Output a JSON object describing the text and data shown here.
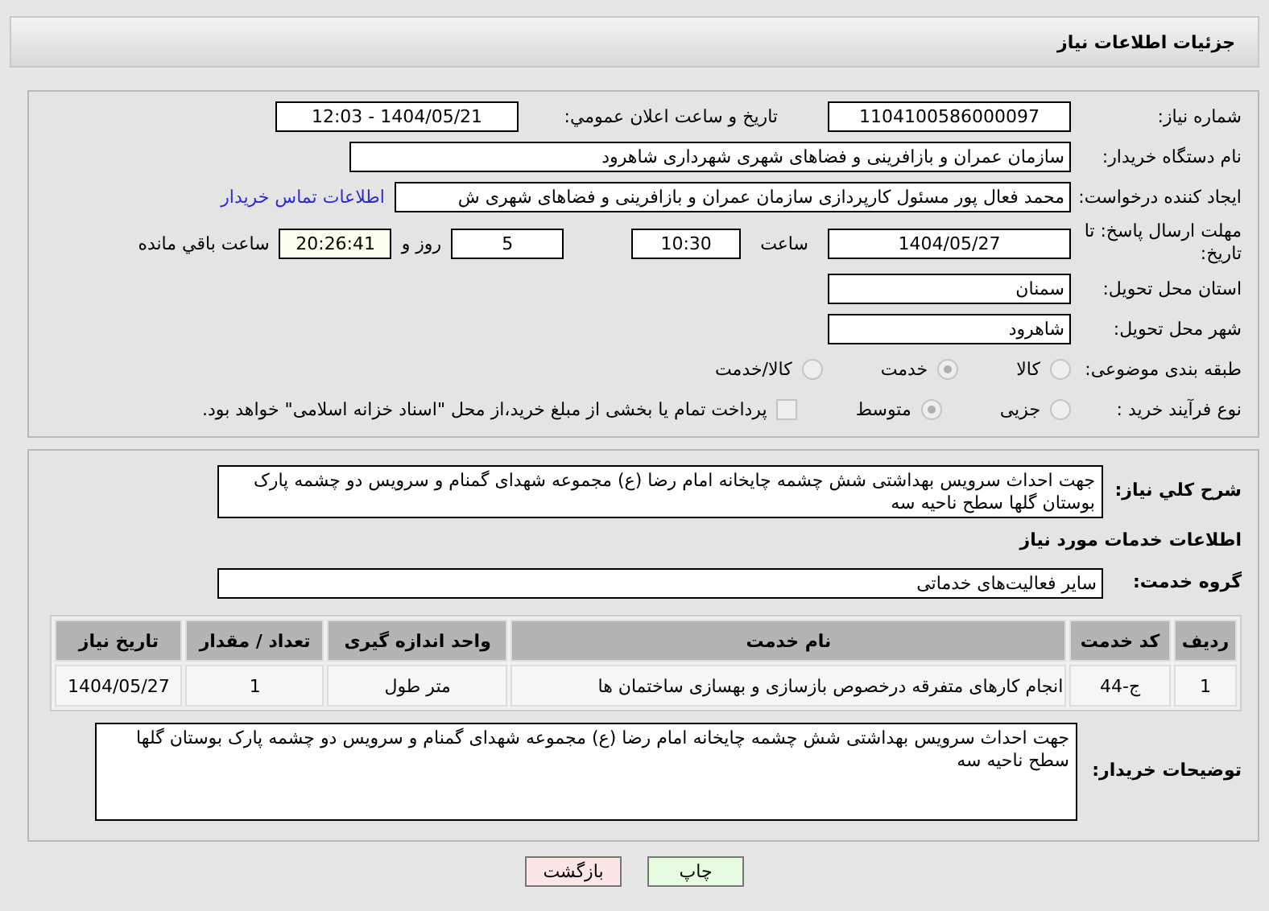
{
  "header": {
    "title": "جزئیات اطلاعات نیاز"
  },
  "details": {
    "need_number": {
      "label": "شماره نیاز:",
      "value": "1104100586000097"
    },
    "announce": {
      "label": "تاریخ و ساعت اعلان عمومي:",
      "value": "1404/05/21 - 12:03"
    },
    "buyer_org": {
      "label": "نام دستگاه خریدار:",
      "value": "سازمان عمران و بازافرینی و فضاهای شهری شهرداری شاهرود"
    },
    "requester": {
      "label": "ایجاد کننده درخواست:",
      "value": "محمد فعال پور مسئول کارپردازی سازمان عمران و بازافرینی و فضاهای شهری ش",
      "link": "اطلاعات تماس خریدار"
    },
    "deadline": {
      "label": "مهلت ارسال پاسخ: تا تاریخ:",
      "date": "1404/05/27",
      "time_label": "ساعت",
      "time": "10:30",
      "days": "5",
      "days_label": "روز و",
      "remaining": "20:26:41",
      "remaining_label": "ساعت باقي مانده"
    },
    "province": {
      "label": "استان محل تحویل:",
      "value": "سمنان"
    },
    "city": {
      "label": "شهر محل تحویل:",
      "value": "شاهرود"
    },
    "category": {
      "label": "طبقه بندی موضوعی:",
      "options": [
        {
          "label": "کالا",
          "selected": false
        },
        {
          "label": "خدمت",
          "selected": true
        },
        {
          "label": "کالا/خدمت",
          "selected": false
        }
      ]
    },
    "process": {
      "label": "نوع فرآیند خرید :",
      "options": [
        {
          "kind": "radio",
          "label": "جزیی",
          "selected": false
        },
        {
          "kind": "radio",
          "label": "متوسط",
          "selected": true
        },
        {
          "kind": "checkbox",
          "label": "پرداخت تمام یا بخشی از مبلغ خرید،از محل \"اسناد خزانه اسلامی\" خواهد بود.",
          "checked": false
        }
      ]
    }
  },
  "services": {
    "description": {
      "label": "شرح کلي نياز:",
      "value": "جهت احداث سرویس بهداشتی شش چشمه چایخانه امام رضا (ع) مجموعه شهدای گمنام و سرویس دو چشمه پارک بوستان گلها سطح ناحیه سه"
    },
    "section_title": "اطلاعات خدمات مورد نیاز",
    "group": {
      "label": "گروه خدمت:",
      "value": "سایر فعالیت‌های خدماتی"
    },
    "table": {
      "columns": [
        "ردیف",
        "کد خدمت",
        "نام خدمت",
        "واحد اندازه گیری",
        "تعداد / مقدار",
        "تاریخ نیاز"
      ],
      "rows": [
        [
          "1",
          "ج-44",
          "انجام کارهای متفرقه درخصوص بازسازی و بهسازی ساختمان ها",
          "متر طول",
          "1",
          "1404/05/27"
        ]
      ]
    },
    "buyer_notes": {
      "label": "توضیحات خریدار:",
      "value": "جهت احداث سرویس بهداشتی شش چشمه چایخانه امام رضا (ع) مجموعه شهدای گمنام و سرویس دو چشمه پارک بوستان گلها سطح ناحیه سه"
    }
  },
  "buttons": [
    {
      "kind": "print",
      "label": "چاپ"
    },
    {
      "kind": "back",
      "label": "بازگشت"
    }
  ]
}
